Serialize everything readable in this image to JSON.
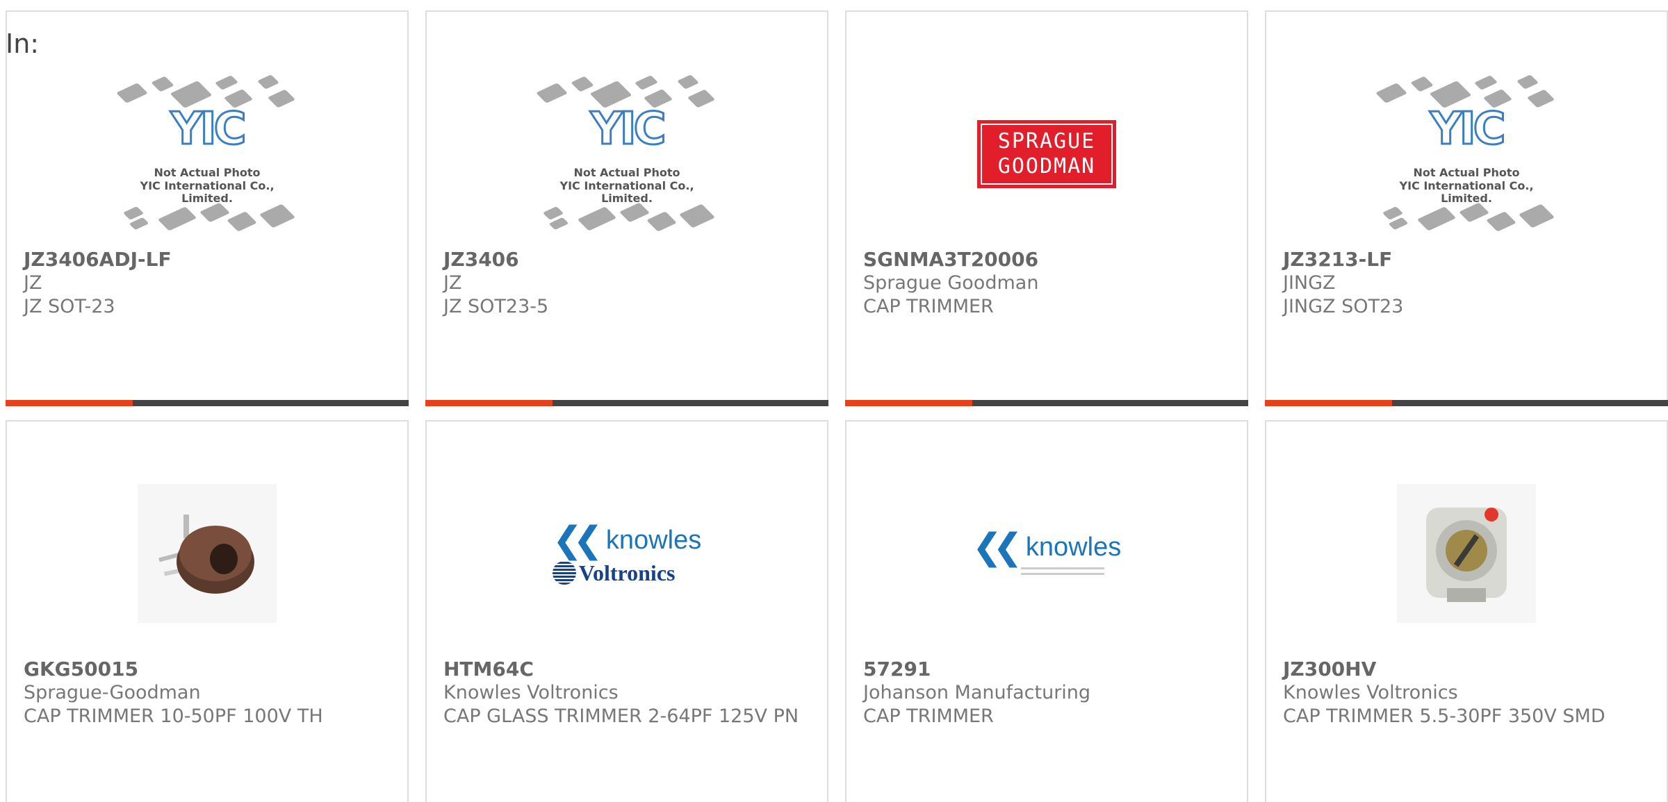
{
  "header": {
    "label": "In:"
  },
  "cards": [
    {
      "part": "JZ3406ADJ-LF",
      "manufacturer": "JZ",
      "description": "JZ SOT-23",
      "image": {
        "type": "placeholder",
        "logo_text": "YIC",
        "note_line1": "Not Actual Photo",
        "note_line2": "YIC International Co., Limited."
      }
    },
    {
      "part": "JZ3406",
      "manufacturer": "JZ",
      "description": "JZ SOT23-5",
      "image": {
        "type": "placeholder",
        "logo_text": "YIC",
        "note_line1": "Not Actual Photo",
        "note_line2": "YIC International Co., Limited."
      }
    },
    {
      "part": "SGNMA3T20006",
      "manufacturer": "Sprague Goodman",
      "description": "CAP TRIMMER",
      "image": {
        "type": "logo",
        "line1": "SPRAGUE",
        "line2": "GOODMAN"
      }
    },
    {
      "part": "JZ3213-LF",
      "manufacturer": "JINGZ",
      "description": "JINGZ SOT23",
      "image": {
        "type": "placeholder",
        "logo_text": "YIC",
        "note_line1": "Not Actual Photo",
        "note_line2": "YIC International Co., Limited."
      }
    },
    {
      "part": "GKG50015",
      "manufacturer": "Sprague-Goodman",
      "description": "CAP TRIMMER 10-50PF 100V TH",
      "image": {
        "type": "photo"
      }
    },
    {
      "part": "HTM64C",
      "manufacturer": "Knowles Voltronics",
      "description": "CAP GLASS TRIMMER 2-64PF 125V PN",
      "image": {
        "type": "logo",
        "word": "knowles",
        "sub": "Voltronics"
      }
    },
    {
      "part": "57291",
      "manufacturer": "Johanson Manufacturing",
      "description": "CAP TRIMMER",
      "image": {
        "type": "logo",
        "word": "knowles"
      }
    },
    {
      "part": "JZ300HV",
      "manufacturer": "Knowles Voltronics",
      "description": "CAP TRIMMER 5.5-30PF 350V SMD",
      "image": {
        "type": "photo"
      }
    }
  ],
  "colors": {
    "accent": "#e8401b",
    "bar": "#444444",
    "border": "#dddddd",
    "knowles_blue": "#1b75bb",
    "sprague_red": "#e31e2b"
  }
}
